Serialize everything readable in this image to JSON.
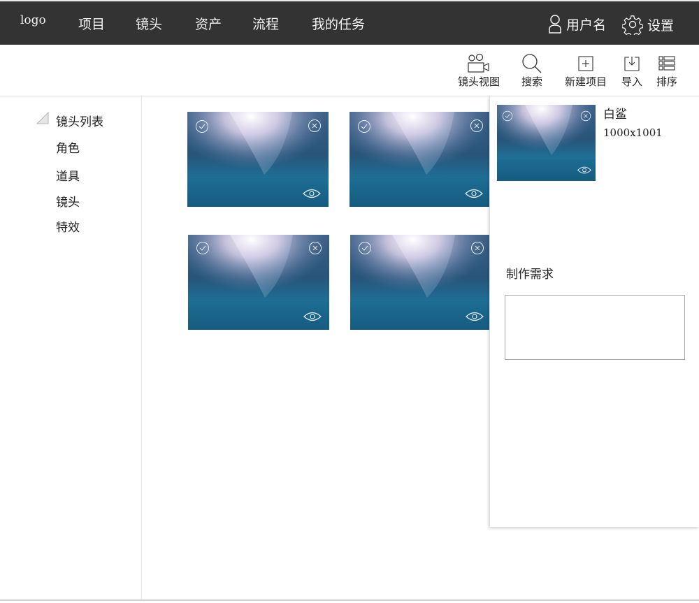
{
  "header": {
    "logo": "logo",
    "nav": [
      "项目",
      "镜头",
      "资产",
      "流程",
      "我的任务"
    ],
    "username": "用户名",
    "settings": "设置"
  },
  "toolbar": {
    "shot_view": "镜头视图",
    "search": "搜索",
    "new_project": "新建项目",
    "import": "导入",
    "sort": "排序"
  },
  "sidebar": {
    "items": [
      {
        "label": "镜头列表",
        "icon": "triangle-expand-icon"
      },
      {
        "label": "角色"
      },
      {
        "label": "道具"
      },
      {
        "label": "镜头"
      },
      {
        "label": "特效"
      }
    ]
  },
  "grid": {
    "cards": [
      {
        "icons": [
          "check-circle-icon",
          "close-circle-icon",
          "eye-icon"
        ]
      },
      {
        "icons": [
          "check-circle-icon",
          "close-circle-icon",
          "eye-icon"
        ]
      },
      {
        "icons": [
          "check-circle-icon",
          "close-circle-icon",
          "eye-icon"
        ]
      },
      {
        "icons": [
          "check-circle-icon",
          "close-circle-icon",
          "eye-icon"
        ]
      }
    ]
  },
  "detail_panel": {
    "name": "白鲨",
    "size": "1000x1001",
    "requirement_label": "制作需求",
    "requirement_value": ""
  }
}
